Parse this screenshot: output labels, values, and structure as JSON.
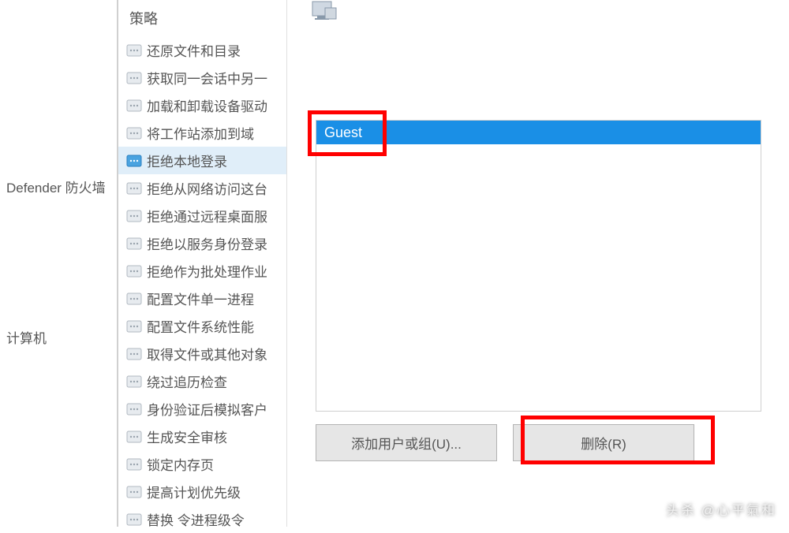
{
  "tree": {
    "defender": "Defender 防火墙",
    "computer": "计算机"
  },
  "middle": {
    "header": "策略",
    "items": [
      "还原文件和目录",
      "获取同一会话中另一",
      "加载和卸载设备驱动",
      "将工作站添加到域",
      "拒绝本地登录",
      "拒绝从网络访问这台",
      "拒绝通过远程桌面服",
      "拒绝以服务身份登录",
      "拒绝作为批处理作业",
      "配置文件单一进程",
      "配置文件系统性能",
      "取得文件或其他对象",
      "绕过追历检查",
      "身份验证后模拟客户",
      "生成安全审核",
      "锁定内存页",
      "提高计划优先级",
      "替换  令进程级令"
    ],
    "selected_index": 4
  },
  "right": {
    "selected_user": "Guest",
    "add_button": "添加用户或组(U)...",
    "delete_button": "删除(R)"
  },
  "watermark": "头杀 @心平氣和"
}
